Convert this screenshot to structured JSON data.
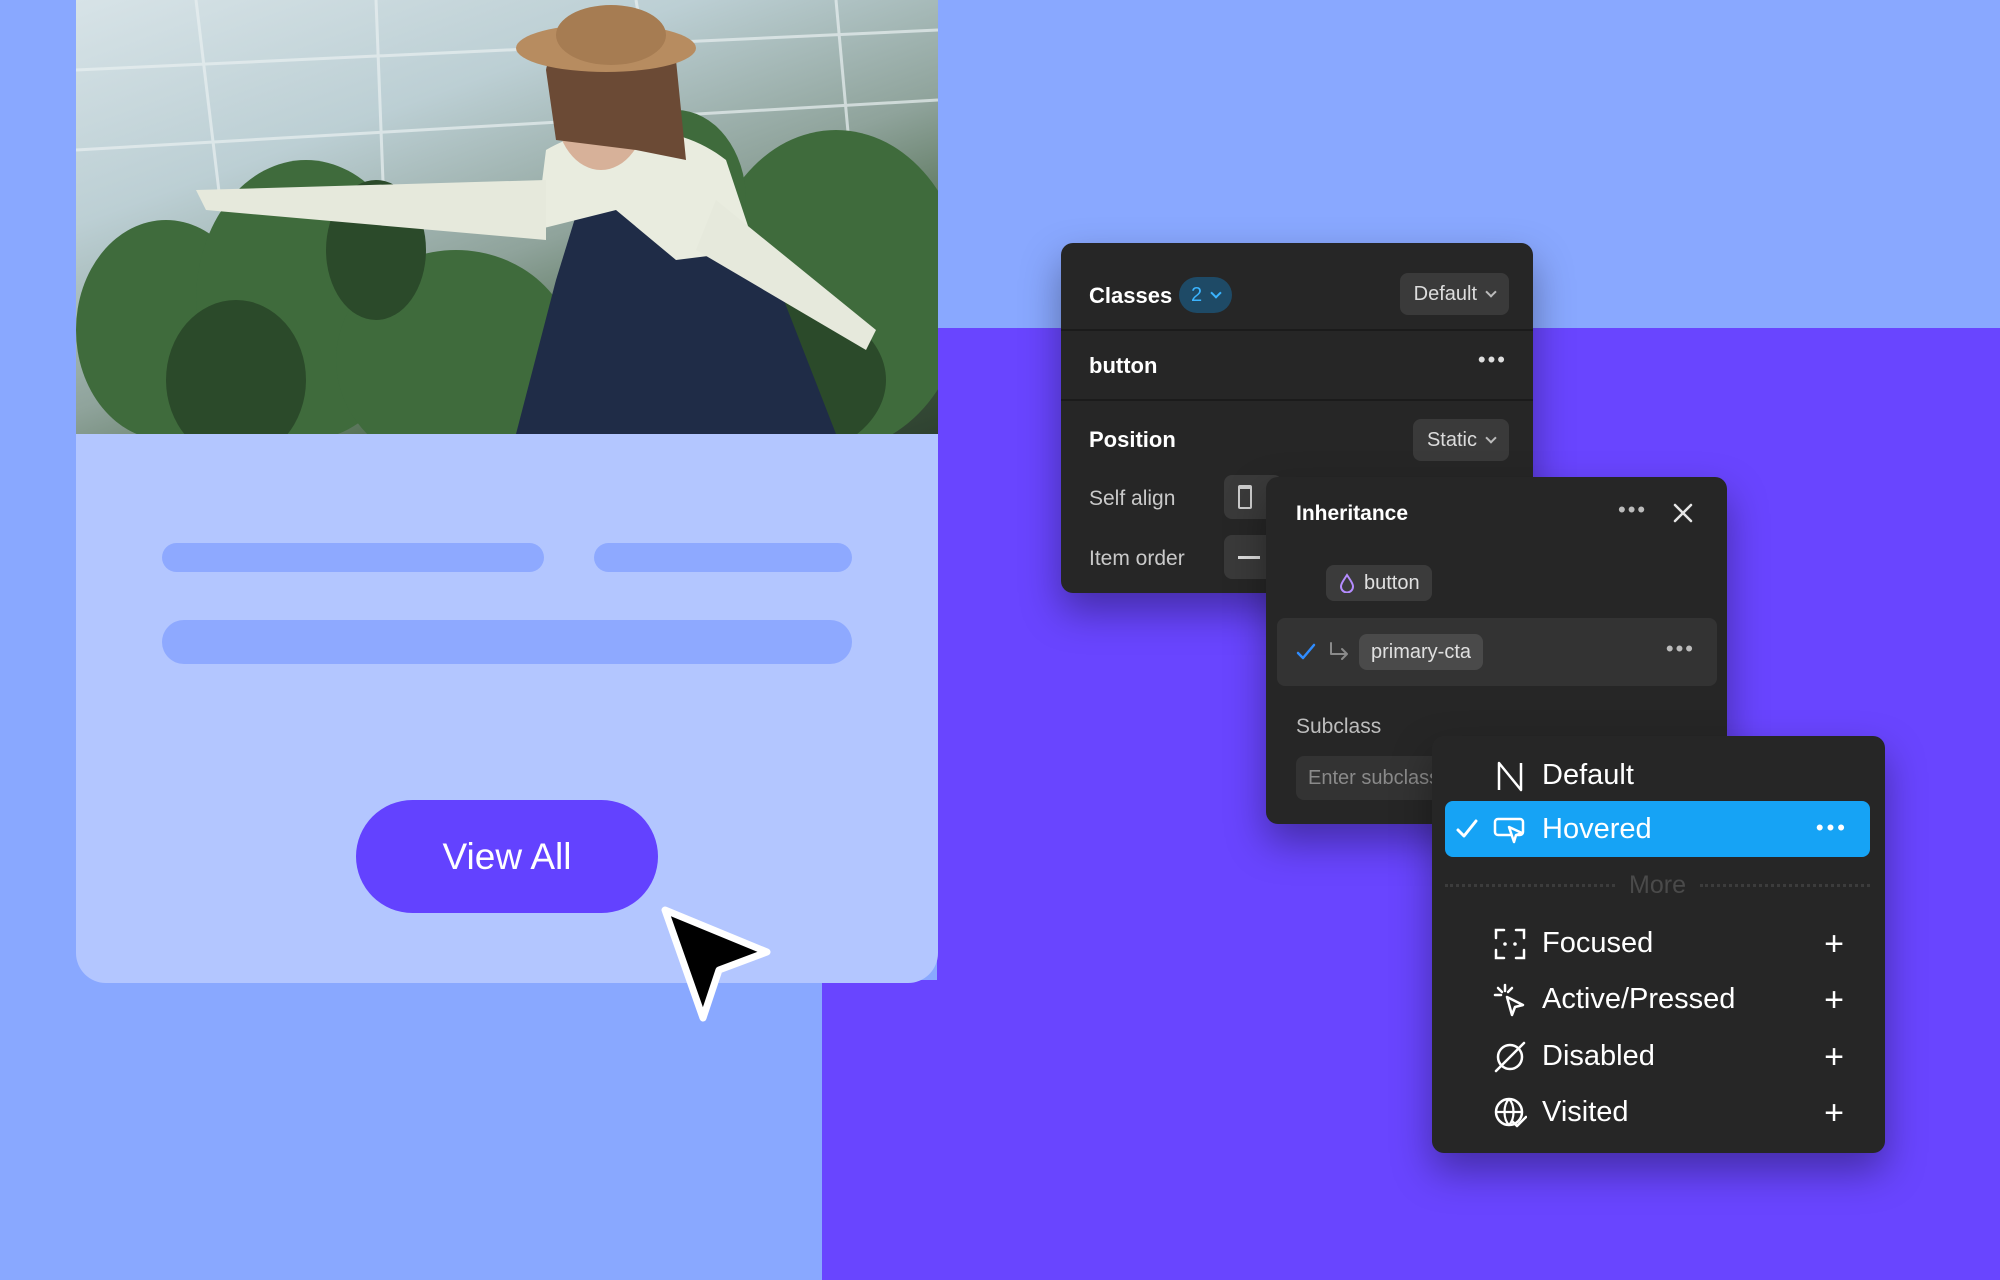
{
  "card": {
    "cta_label": "View All"
  },
  "classes_panel": {
    "title": "Classes",
    "count": "2",
    "state_select": "Default",
    "class_name": "button",
    "position_label": "Position",
    "position_value": "Static",
    "self_align_label": "Self align",
    "item_order_label": "Item order"
  },
  "inheritance_panel": {
    "title": "Inheritance",
    "base_class": "button",
    "combo_class": "primary-cta",
    "subclass_label": "Subclass",
    "subclass_placeholder": "Enter subclass"
  },
  "states_menu": {
    "items": [
      {
        "label": "Default",
        "icon": "n-icon"
      },
      {
        "label": "Hovered",
        "icon": "hover-icon",
        "selected": true
      },
      {
        "label": "Focused",
        "icon": "focus-icon"
      },
      {
        "label": "Active/Pressed",
        "icon": "click-icon"
      },
      {
        "label": "Disabled",
        "icon": "disabled-icon"
      },
      {
        "label": "Visited",
        "icon": "globe-icon"
      }
    ],
    "more_label": "More"
  },
  "colors": {
    "background_light": "#89a8ff",
    "background_purple": "#6945ff",
    "accent_blue": "#16a3f5",
    "button_purple": "#6342ff",
    "panel_dark": "#262626"
  }
}
